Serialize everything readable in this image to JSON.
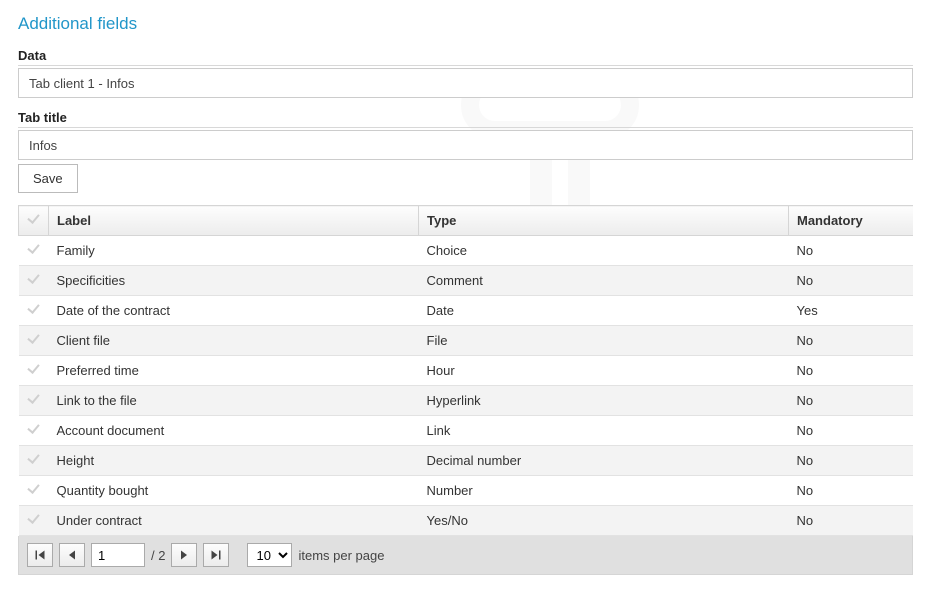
{
  "section": {
    "title": "Additional fields"
  },
  "data_field": {
    "label": "Data",
    "value": "Tab client 1 - Infos"
  },
  "tab_title_field": {
    "label": "Tab title",
    "value": "Infos"
  },
  "buttons": {
    "save": "Save"
  },
  "table": {
    "headers": {
      "label": "Label",
      "type": "Type",
      "mandatory": "Mandatory"
    },
    "rows": [
      {
        "label": "Family",
        "type": "Choice",
        "mandatory": "No"
      },
      {
        "label": "Specificities",
        "type": "Comment",
        "mandatory": "No"
      },
      {
        "label": "Date of the contract",
        "type": "Date",
        "mandatory": "Yes"
      },
      {
        "label": "Client file",
        "type": "File",
        "mandatory": "No"
      },
      {
        "label": "Preferred time",
        "type": "Hour",
        "mandatory": "No"
      },
      {
        "label": "Link to the file",
        "type": "Hyperlink",
        "mandatory": "No"
      },
      {
        "label": "Account document",
        "type": "Link",
        "mandatory": "No"
      },
      {
        "label": "Height",
        "type": "Decimal number",
        "mandatory": "No"
      },
      {
        "label": "Quantity bought",
        "type": "Number",
        "mandatory": "No"
      },
      {
        "label": "Under contract",
        "type": "Yes/No",
        "mandatory": "No"
      }
    ]
  },
  "pager": {
    "current_page": "1",
    "total_pages": "2",
    "page_sep": " / ",
    "page_size": "10",
    "items_label": "items per page"
  }
}
